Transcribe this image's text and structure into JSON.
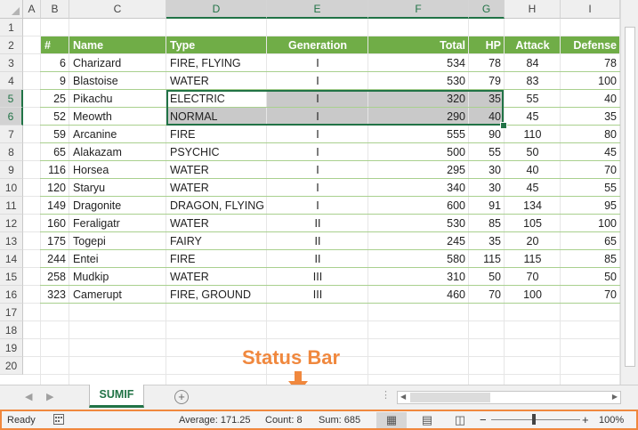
{
  "columns": [
    "A",
    "B",
    "C",
    "D",
    "E",
    "F",
    "G",
    "H",
    "I"
  ],
  "selected_columns": [
    "D",
    "E",
    "F",
    "G"
  ],
  "rows": [
    "1",
    "2",
    "3",
    "4",
    "5",
    "6",
    "7",
    "8",
    "9",
    "10",
    "11",
    "12",
    "13",
    "14",
    "15",
    "16",
    "17",
    "18",
    "19",
    "20"
  ],
  "selected_rows": [
    "5",
    "6"
  ],
  "table": {
    "headers": [
      "#",
      "Name",
      "Type",
      "Generation",
      "Total",
      "HP",
      "Attack",
      "Defense"
    ],
    "rows": [
      [
        "6",
        "Charizard",
        "FIRE, FLYING",
        "I",
        "534",
        "78",
        "84",
        "78"
      ],
      [
        "9",
        "Blastoise",
        "WATER",
        "I",
        "530",
        "79",
        "83",
        "100"
      ],
      [
        "25",
        "Pikachu",
        "ELECTRIC",
        "I",
        "320",
        "35",
        "55",
        "40"
      ],
      [
        "52",
        "Meowth",
        "NORMAL",
        "I",
        "290",
        "40",
        "45",
        "35"
      ],
      [
        "59",
        "Arcanine",
        "FIRE",
        "I",
        "555",
        "90",
        "110",
        "80"
      ],
      [
        "65",
        "Alakazam",
        "PSYCHIC",
        "I",
        "500",
        "55",
        "50",
        "45"
      ],
      [
        "116",
        "Horsea",
        "WATER",
        "I",
        "295",
        "30",
        "40",
        "70"
      ],
      [
        "120",
        "Staryu",
        "WATER",
        "I",
        "340",
        "30",
        "45",
        "55"
      ],
      [
        "149",
        "Dragonite",
        "DRAGON, FLYING",
        "I",
        "600",
        "91",
        "134",
        "95"
      ],
      [
        "160",
        "Feraligatr",
        "WATER",
        "II",
        "530",
        "85",
        "105",
        "100"
      ],
      [
        "175",
        "Togepi",
        "FAIRY",
        "II",
        "245",
        "35",
        "20",
        "65"
      ],
      [
        "244",
        "Entei",
        "FIRE",
        "II",
        "580",
        "115",
        "115",
        "85"
      ],
      [
        "258",
        "Mudkip",
        "WATER",
        "III",
        "310",
        "50",
        "70",
        "50"
      ],
      [
        "323",
        "Camerupt",
        "FIRE, GROUND",
        "III",
        "460",
        "70",
        "100",
        "70"
      ]
    ]
  },
  "sheet_tab": "SUMIF",
  "status": {
    "ready": "Ready",
    "average": "Average: 171.25",
    "count": "Count: 8",
    "sum": "Sum: 685",
    "zoom": "100%"
  },
  "annotation": "Status Bar",
  "colors": {
    "accent": "#217346",
    "table_header": "#70ad47",
    "annotation": "#f0883e"
  }
}
